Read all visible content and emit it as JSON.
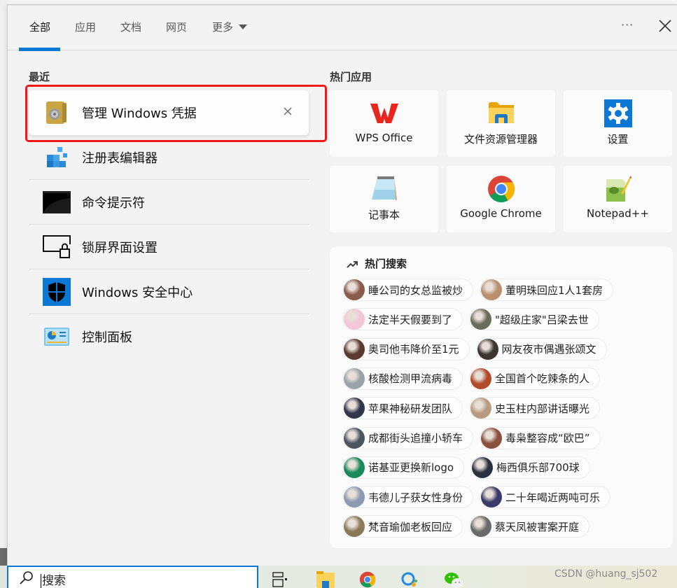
{
  "tabs": [
    {
      "label": "全部",
      "active": true
    },
    {
      "label": "应用"
    },
    {
      "label": "文档"
    },
    {
      "label": "网页"
    },
    {
      "label": "更多"
    }
  ],
  "header": {
    "more_label": "···",
    "close_icon": "close-icon"
  },
  "recent": {
    "title": "最近",
    "items": [
      {
        "label": "管理 Windows 凭据",
        "icon": "credential-manager-icon",
        "selected": true
      },
      {
        "label": "注册表编辑器",
        "icon": "registry-editor-icon"
      },
      {
        "label": "命令提示符",
        "icon": "command-prompt-icon"
      },
      {
        "label": "锁屏界面设置",
        "icon": "lock-screen-icon"
      },
      {
        "label": "Windows 安全中心",
        "icon": "windows-security-icon"
      },
      {
        "label": "控制面板",
        "icon": "control-panel-icon"
      }
    ]
  },
  "hot_apps": {
    "title": "热门应用",
    "items": [
      {
        "label": "WPS Office",
        "icon": "wps-office-icon"
      },
      {
        "label": "文件资源管理器",
        "icon": "file-explorer-icon"
      },
      {
        "label": "设置",
        "icon": "settings-gear-icon"
      },
      {
        "label": "记事本",
        "icon": "notepad-icon"
      },
      {
        "label": "Google Chrome",
        "icon": "chrome-icon"
      },
      {
        "label": "Notepad++",
        "icon": "notepad-plus-plus-icon"
      }
    ]
  },
  "hot_search": {
    "title": "热门搜索",
    "rows": [
      [
        "睡公司的女总监被炒",
        "董明珠回应1人1套房"
      ],
      [
        "法定半天假要到了",
        "\"超级庄家\"吕梁去世"
      ],
      [
        "奥司他韦降价至1元",
        "网友夜市偶遇张颂文"
      ],
      [
        "核酸检测甲流病毒",
        "全国首个吃辣条的人"
      ],
      [
        "苹果神秘研发团队",
        "史玉柱内部讲话曝光"
      ],
      [
        "成都街头追撞小轿车",
        "毒枭整容成“欧巴”"
      ],
      [
        "诺基亚更换新logo",
        "梅西俱乐部700球"
      ],
      [
        "韦德儿子获女性身份",
        "二十年喝近两吨可乐"
      ],
      [
        "梵音瑜伽老板回应",
        "蔡天凤被害案开庭"
      ]
    ],
    "avatar_colors": [
      [
        "#8a5a4a",
        "#b89070"
      ],
      [
        "#f3c6d8",
        "#6b6b5a"
      ],
      [
        "#5a3a30",
        "#3a3530"
      ],
      [
        "#9aa3a8",
        "#b04a2a"
      ],
      [
        "#30354a",
        "#b89a80"
      ],
      [
        "#4a5560",
        "#8a5040"
      ],
      [
        "#1a8a5a",
        "#2a3040"
      ],
      [
        "#8a9ab0",
        "#3a3a6a"
      ],
      [
        "#8a7a5a",
        "#6a6a6a"
      ]
    ]
  },
  "taskbar": {
    "search_placeholder": "搜索",
    "watermark": "CSDN @huang_sj502"
  },
  "colors": {
    "accent": "#0a78d4",
    "highlight": "#f01818"
  }
}
